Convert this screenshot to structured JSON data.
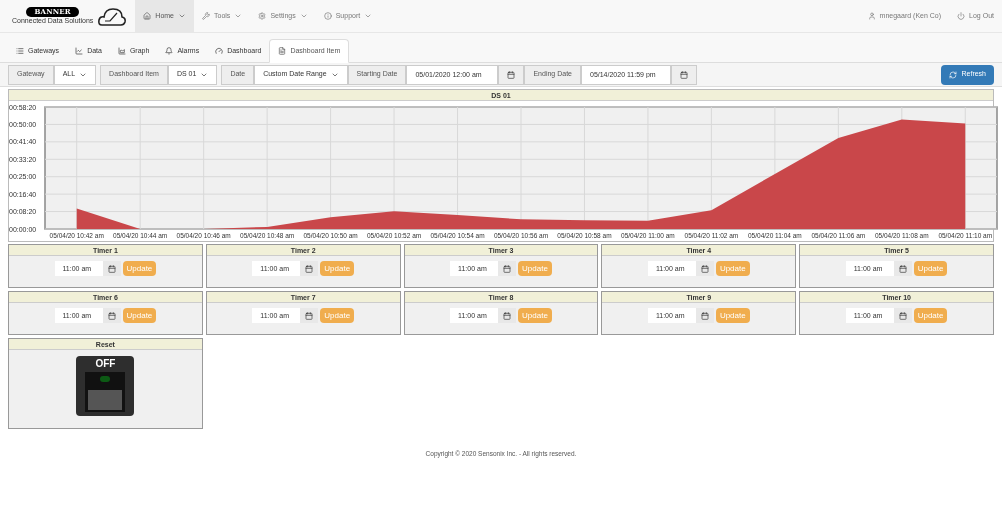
{
  "brand": {
    "name": "BANNER",
    "tagline": "Connected Data Solutions"
  },
  "nav": [
    {
      "label": "Home",
      "selected": true
    },
    {
      "label": "Tools",
      "selected": false
    },
    {
      "label": "Settings",
      "selected": false
    },
    {
      "label": "Support",
      "selected": false
    }
  ],
  "user": {
    "name": "mnegaard (Ken Co)",
    "logout": "Log Out"
  },
  "tabs": [
    {
      "label": "Gateways",
      "selected": false
    },
    {
      "label": "Data",
      "selected": false
    },
    {
      "label": "Graph",
      "selected": false
    },
    {
      "label": "Alarms",
      "selected": false
    },
    {
      "label": "Dashboard",
      "selected": false
    },
    {
      "label": "Dashboard Item",
      "selected": true
    }
  ],
  "filters": {
    "gateway_label": "Gateway",
    "gateway": "ALL",
    "item_label": "Dashboard Item",
    "item": "DS 01",
    "date_label": "Date",
    "date": "Custom Date Range",
    "start_label": "Starting Date",
    "start": "05/01/2020 12:00 am",
    "end_label": "Ending Date",
    "end": "05/14/2020 11:59 pm",
    "refresh": "Refresh"
  },
  "chart": {
    "title": "DS 01",
    "chart_data": {
      "type": "area",
      "categories": [
        "05/04/20 10:42 am",
        "05/04/20 10:44 am",
        "05/04/20 10:46 am",
        "05/04/20 10:48 am",
        "05/04/20 10:50 am",
        "05/04/20 10:52 am",
        "05/04/20 10:54 am",
        "05/04/20 10:56 am",
        "05/04/20 10:58 am",
        "05/04/20 11:00 am",
        "05/04/20 11:02 am",
        "05/04/20 11:04 am",
        "05/04/20 11:06 am",
        "05/04/20 11:08 am",
        "05/04/20 11:10 am"
      ],
      "series": [
        {
          "color": "#c9474a",
          "values": [
            590,
            0,
            0,
            60,
            340,
            510,
            400,
            280,
            250,
            240,
            540,
            1580,
            2610,
            3140,
            3030
          ]
        }
      ],
      "ylim": [
        0,
        3500
      ],
      "grid": true,
      "yticks": [
        {
          "value": 0,
          "label": "00:00:00"
        },
        {
          "value": 500,
          "label": "00:08:20"
        },
        {
          "value": 1000,
          "label": "00:16:40"
        },
        {
          "value": 1500,
          "label": "00:25:00"
        },
        {
          "value": 2000,
          "label": "00:33:20"
        },
        {
          "value": 2500,
          "label": "00:41:40"
        },
        {
          "value": 3000,
          "label": "00:50:00"
        },
        {
          "value": 3500,
          "label": "00:58:20"
        }
      ]
    }
  },
  "timers": [
    {
      "title": "Timer 1",
      "time": "11:00 am",
      "button": "Update"
    },
    {
      "title": "Timer 2",
      "time": "11:00 am",
      "button": "Update"
    },
    {
      "title": "Timer 3",
      "time": "11:00 am",
      "button": "Update"
    },
    {
      "title": "Timer 4",
      "time": "11:00 am",
      "button": "Update"
    },
    {
      "title": "Timer 5",
      "time": "11:00 am",
      "button": "Update"
    },
    {
      "title": "Timer 6",
      "time": "11:00 am",
      "button": "Update"
    },
    {
      "title": "Timer 7",
      "time": "11:00 am",
      "button": "Update"
    },
    {
      "title": "Timer 8",
      "time": "11:00 am",
      "button": "Update"
    },
    {
      "title": "Timer 9",
      "time": "11:00 am",
      "button": "Update"
    },
    {
      "title": "Timer 10",
      "time": "11:00 am",
      "button": "Update"
    }
  ],
  "reset": {
    "title": "Reset",
    "switch_label": "OFF",
    "on": false
  },
  "footer": "Copyright © 2020 Sensonix Inc. - All rights reserved."
}
